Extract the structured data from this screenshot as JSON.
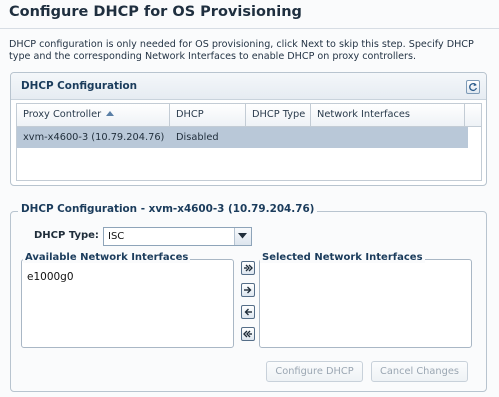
{
  "page": {
    "title": "Configure DHCP for OS Provisioning",
    "intro": "DHCP configuration is only needed for OS provisioning, click Next to skip this step. Specify DHCP type and the corresponding Network Interfaces to enable DHCP on proxy controllers."
  },
  "dhcp_panel": {
    "title": "DHCP Configuration",
    "refresh_icon": "refresh-icon",
    "columns": [
      "Proxy Controller",
      "DHCP",
      "DHCP Type",
      "Network Interfaces"
    ],
    "sort_column": "Proxy Controller",
    "rows": [
      {
        "proxy_controller": "xvm-x4600-3 (10.79.204.76)",
        "dhcp": "Disabled",
        "dhcp_type": "",
        "network_interfaces": ""
      }
    ],
    "selected_row_color": "#b9c8d8"
  },
  "detail": {
    "legend": "DHCP Configuration - xvm-x4600-3 (10.79.204.76)",
    "dhcp_type_label": "DHCP Type:",
    "dhcp_type_value": "ISC",
    "available_label": "Available Network Interfaces",
    "available_items": [
      "e1000g0"
    ],
    "selected_label": "Selected Network Interfaces",
    "selected_items": [],
    "shuttle_buttons": [
      "move-all-right-icon",
      "move-right-icon",
      "move-left-icon",
      "move-all-left-icon"
    ],
    "configure_button": "Configure DHCP",
    "cancel_button": "Cancel Changes"
  }
}
